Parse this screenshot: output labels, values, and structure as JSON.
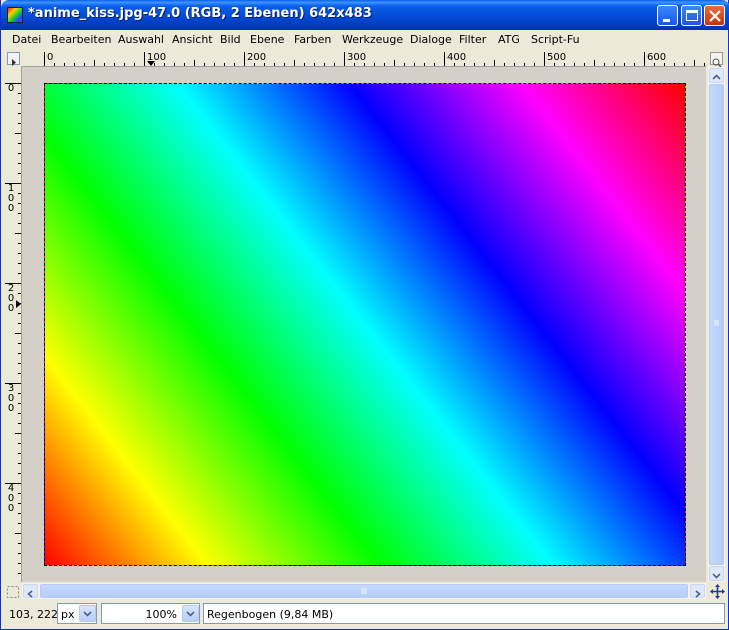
{
  "window": {
    "title": "*anime_kiss.jpg-47.0 (RGB, 2 Ebenen) 642x483",
    "app_icon": "gimp-icon"
  },
  "menu": {
    "items": [
      {
        "label": "Datei"
      },
      {
        "label": "Bearbeiten"
      },
      {
        "label": "Auswahl"
      },
      {
        "label": "Ansicht"
      },
      {
        "label": "Bild"
      },
      {
        "label": "Ebene"
      },
      {
        "label": "Farben"
      },
      {
        "label": "Werkzeuge"
      },
      {
        "label": "Dialoge"
      },
      {
        "label": "Filter"
      },
      {
        "label": "ATG"
      },
      {
        "label": "Script-Fu"
      }
    ]
  },
  "rulers": {
    "horizontal": [
      "0",
      "100",
      "200",
      "300",
      "400",
      "500",
      "600"
    ],
    "vertical": [
      "0",
      "100",
      "200",
      "300",
      "400"
    ]
  },
  "canvas": {
    "image_fill": "rainbow-gradient",
    "colors": [
      "#ff0000",
      "#ffff00",
      "#00ff00",
      "#00ffff",
      "#0000ff",
      "#ff00ff"
    ]
  },
  "status": {
    "coords": "103, 222",
    "unit": "px",
    "zoom": "100%",
    "message": "Regenbogen (9,84 MB)"
  }
}
